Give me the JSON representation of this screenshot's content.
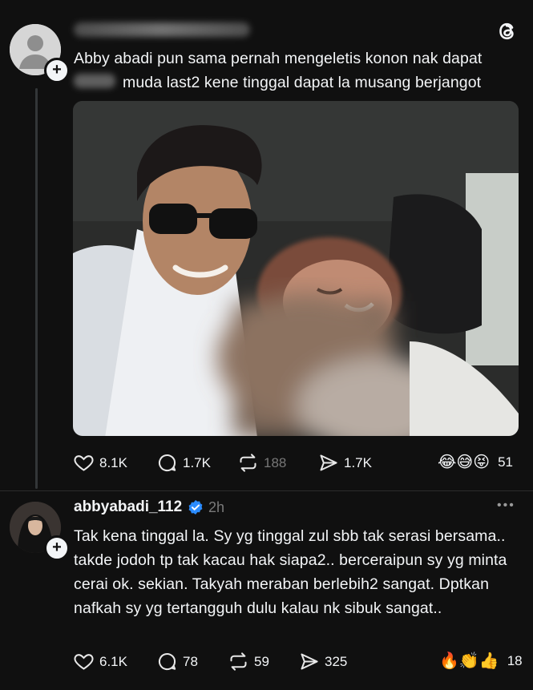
{
  "post1": {
    "text_line1": "Abby abadi pun sama pernah mengeletis konon nak dapat",
    "text_line2": "muda last2 kene tinggal dapat la musang berjangot",
    "likes": "8.1K",
    "replies": "1.7K",
    "reposts": "188",
    "shares": "1.7K",
    "reactions_emoji": "😂😅😝",
    "reactions_count": "51"
  },
  "post2": {
    "username": "abbyabadi_112",
    "time": "2h",
    "text": "Tak kena tinggal la. Sy yg tinggal zul sbb tak serasi bersama.. takde jodoh tp tak kacau hak siapa2.. berceraipun sy yg minta cerai ok. sekian. Takyah meraban berlebih2 sangat. Dptkan nafkah sy yg tertangguh dulu kalau nk sibuk sangat..",
    "likes": "6.1K",
    "replies": "78",
    "reposts": "59",
    "shares": "325",
    "reactions_emoji": "🔥👏👍",
    "reactions_count": "18",
    "more": "•••"
  },
  "plus_glyph": "+",
  "icons": {
    "app": "threads-logo-icon",
    "like": "heart-icon",
    "reply": "comment-icon",
    "repost": "repost-icon",
    "share": "share-icon",
    "verified": "verified-badge-icon"
  }
}
